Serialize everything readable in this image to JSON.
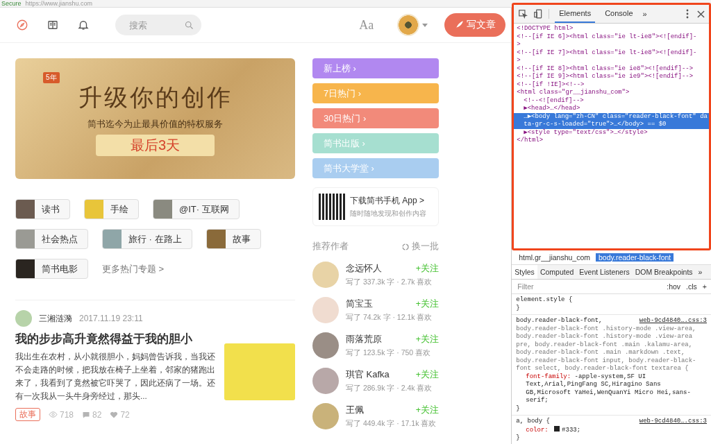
{
  "address_bar": {
    "secure": "Secure",
    "url": "https://www.jianshu.com"
  },
  "header": {
    "search": {
      "placeholder": "搜索"
    },
    "font_toggle": "Aa",
    "write_button": "写文章"
  },
  "banner": {
    "badge": "5年",
    "headline": "升级你的创作",
    "subtitle": "简书迄今为止最具价值的特权服务",
    "countdown": "最后3天"
  },
  "topics": [
    {
      "label": "读书"
    },
    {
      "label": "手绘"
    },
    {
      "label": "@IT· 互联网"
    },
    {
      "label": "社会热点"
    },
    {
      "label": "旅行 · 在路上"
    },
    {
      "label": "故事"
    },
    {
      "label": "简书电影"
    }
  ],
  "more_topics": "更多热门专题 >",
  "article": {
    "author": "三湘涟漪",
    "date": "2017.11.19 23:11",
    "title": "我的步步高升竟然得益于我的胆小",
    "summary": "我出生在农村，从小就很胆小，妈妈曾告诉我，当我还不会走路的时候，把我放在椅子上坐着，邻家的猪跑出来了，我看到了竟然被它吓哭了，因此还病了一场。还有一次我从一头牛身旁经过，那头...",
    "tag": "故事",
    "views": "718",
    "comments": "82",
    "likes": "72"
  },
  "boards": [
    {
      "label": "新上榜 ›",
      "color": "#b188f0"
    },
    {
      "label": "7日热门 ›",
      "color": "#f7b54c"
    },
    {
      "label": "30日热门 ›",
      "color": "#f28a7a"
    },
    {
      "label": "简书出版 ›",
      "color": "#a6dfd0"
    },
    {
      "label": "简书大学堂 ›",
      "color": "#a9cdf0"
    }
  ],
  "app_download": {
    "title": "下载简书手机 App >",
    "subtitle": "随时随地发现和创作内容"
  },
  "recommended": {
    "title": "推荐作者",
    "refresh": "换一批",
    "authors": [
      {
        "name": "念远怀人",
        "stats": "写了 337.3k 字 · 2.7k 喜欢",
        "follow": "+关注"
      },
      {
        "name": "简宝玉",
        "stats": "写了 74.2k 字 · 12.1k 喜欢",
        "follow": "+关注"
      },
      {
        "name": "雨落荒原",
        "stats": "写了 123.5k 字 · 750 喜欢",
        "follow": "+关注"
      },
      {
        "name": "琪官 Kafka",
        "stats": "写了 286.9k 字 · 2.4k 喜欢",
        "follow": "+关注"
      },
      {
        "name": "王佩",
        "stats": "写了 449.4k 字 · 17.1k 喜欢",
        "follow": "+关注"
      }
    ]
  },
  "devtools": {
    "tabs": [
      {
        "label": "Elements",
        "selected": true
      },
      {
        "label": "Console",
        "selected": false
      }
    ],
    "more_tabs": "»",
    "dom": [
      {
        "text": "<!DOCTYPE html>",
        "selected": false
      },
      {
        "text": "<!--[if IE 6]><html class=\"ie lt-ie8\"><![endif]-",
        "selected": false
      },
      {
        "text": ">",
        "selected": false
      },
      {
        "text": "<!--[if IE 7]><html class=\"ie lt-ie8\"><![endif]-",
        "selected": false
      },
      {
        "text": ">",
        "selected": false
      },
      {
        "text": "<!--[if IE 8]><html class=\"ie ie8\"><![endif]-->",
        "selected": false
      },
      {
        "text": "<!--[if IE 9]><html class=\"ie ie9\"><![endif]-->",
        "selected": false
      },
      {
        "text": "<!--[if !IE]><!-->",
        "selected": false
      },
      {
        "text": "<html class=\"gr__jianshu_com\">",
        "selected": false,
        "children": [
          {
            "text": "<!--<![endif]-->",
            "selected": false
          },
          {
            "text": "▶<head>…</head>",
            "selected": false
          },
          {
            "text": "…▶<body lang=\"zh-CN\" class=\"reader-black-font\" data-gr-c-s-loaded=\"true\">…</body> == $0",
            "selected": true
          },
          {
            "text": "▶<style type=\"text/css\">…</style>",
            "selected": false
          }
        ]
      },
      {
        "text": "</html>",
        "selected": false
      }
    ],
    "breadcrumbs": [
      {
        "label": "html.gr__jianshu_com",
        "selected": false
      },
      {
        "label": "body.reader-black-font",
        "selected": true
      }
    ],
    "style_tabs": [
      {
        "label": "Styles",
        "selected": true
      },
      {
        "label": "Computed",
        "selected": false
      },
      {
        "label": "Event Listeners",
        "selected": false
      },
      {
        "label": "DOM Breakpoints",
        "selected": false
      }
    ],
    "style_more": "»",
    "filter": {
      "placeholder": "Filter"
    },
    "hov": ":hov",
    "cls": ".cls",
    "add": "+",
    "rules": [
      {
        "selector": "element.style {",
        "close": "}"
      },
      {
        "selector": "body.reader-black-font,",
        "source": "web-9cd4840….css:3",
        "selector_rest": "body.reader-black-font .history-mode .view-area, body.reader-black-font .history-mode .view-area pre, body.reader-black-font .main .kalamu-area, body.reader-black-font .main .markdown .text, body.reader-black-font input, body.reader-black-font select, body.reader-black-font textarea {",
        "declarations": [
          {
            "property": "font-family:",
            "kind": "plain",
            "value": "-apple-system,SF UI Text,Arial,PingFang SC,Hiragino Sans GB,Microsoft YaHei,WenQuanYi Micro Hei,sans-serif;"
          }
        ],
        "close": "}"
      },
      {
        "selector": "a, body {",
        "source": "web-9cd4840….css:3",
        "declarations": [
          {
            "property": "color:",
            "value": "#333;",
            "kind": "color"
          }
        ],
        "close": "}"
      }
    ]
  }
}
